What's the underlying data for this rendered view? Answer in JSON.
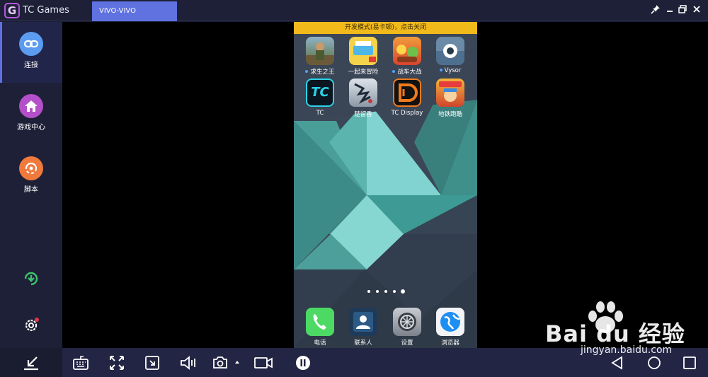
{
  "titlebar": {
    "logo_letter": "G",
    "app_name": "TC Games",
    "device_tab": "VIVO-VIVO"
  },
  "sidebar": {
    "items": [
      {
        "label": "连接",
        "icon": "link-icon",
        "color": "#5b9bf0"
      },
      {
        "label": "游戏中心",
        "icon": "home-icon",
        "color": "#b34fc8"
      },
      {
        "label": "脚本",
        "icon": "script-icon",
        "color": "#f07a3c"
      }
    ]
  },
  "phone": {
    "banner": "开发模式(易卡顿)，点击关闭",
    "apps_row1": [
      {
        "label": "求生之王",
        "dot": true
      },
      {
        "label": "一起来冒险",
        "dot": false
      },
      {
        "label": "战车大战",
        "dot": true
      },
      {
        "label": "Vysor",
        "dot": true
      }
    ],
    "apps_row2": [
      {
        "label": "TC",
        "dot": false
      },
      {
        "label": "楚留香",
        "dot": false
      },
      {
        "label": "TC Display",
        "dot": false
      },
      {
        "label": "地铁跑酷",
        "dot": false
      }
    ],
    "dock": [
      {
        "label": "电话"
      },
      {
        "label": "联系人"
      },
      {
        "label": "设置"
      },
      {
        "label": "浏览器"
      }
    ],
    "tc_icon_text": "TC"
  },
  "watermark": {
    "brand": "Bai du 经验",
    "url": "jingyan.baidu.com"
  }
}
